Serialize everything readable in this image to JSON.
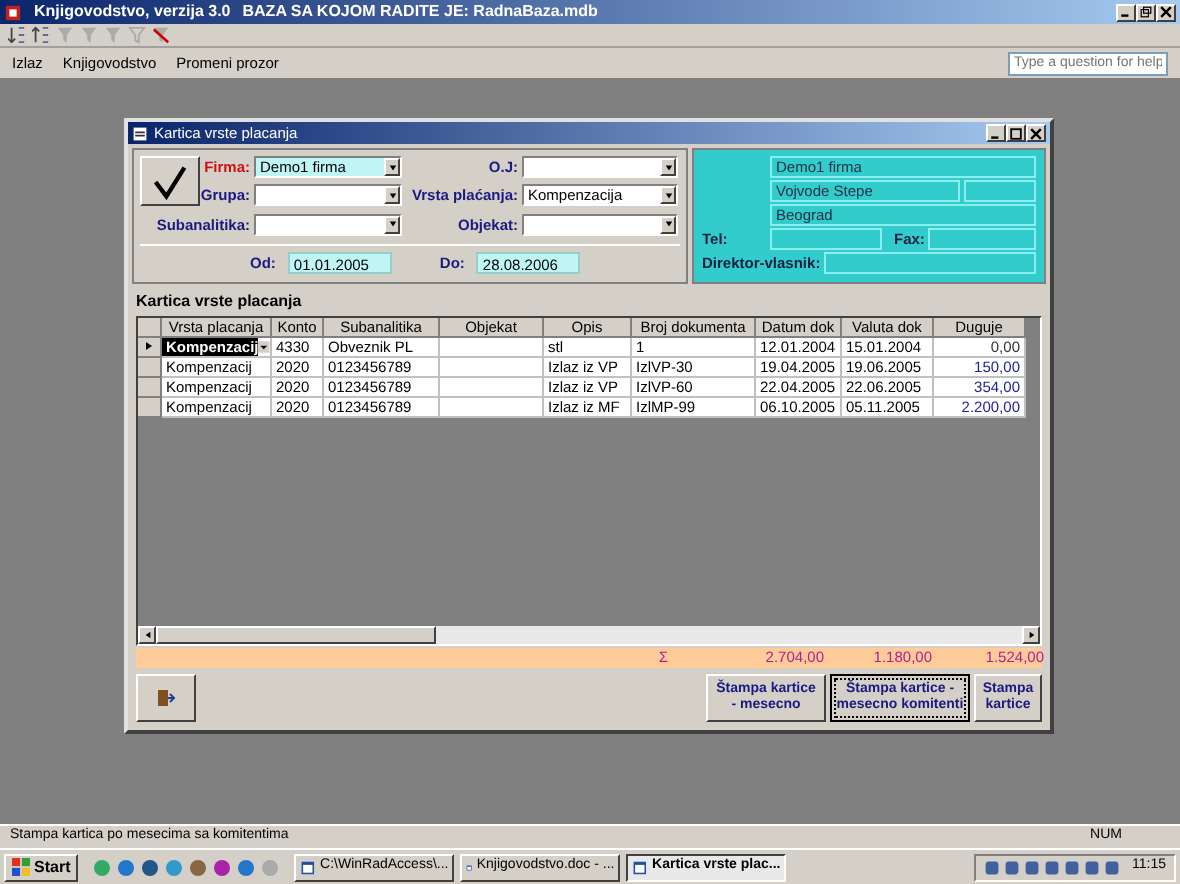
{
  "app_window": {
    "title": "Knjigovodstvo, verzija 3.0",
    "database": "BAZA SA KOJOM RADITE JE: RadnaBaza.mdb"
  },
  "menu": [
    "Izlaz",
    "Knjigovodstvo",
    "Promeni prozor"
  ],
  "help": {
    "placeholder": "Type a question for help"
  },
  "dialog": {
    "title": "Kartica vrste placanja",
    "fields": [
      {
        "label": "Firma:",
        "value": "Demo1 firma",
        "required": true,
        "highlighted": true
      },
      {
        "label": "O.J:",
        "required": false,
        "highlighted": false
      },
      {
        "label": "Grupa:",
        "required": false,
        "highlighted": false
      },
      {
        "label": "Vrsta plaćanja:",
        "value": "Kompenzacija",
        "required": false,
        "highlighted": false
      },
      {
        "label": "Subanalitika:",
        "required": false,
        "highlighted": false
      },
      {
        "label": "Objekat:",
        "required": false,
        "highlighted": false
      }
    ],
    "date_from": {
      "label": "Od:",
      "value": "01.01.2005"
    },
    "date_to": {
      "label": "Do:",
      "value": "28.08.2006"
    },
    "info_panel": {
      "company": "Demo1 firma",
      "address": "Vojvode Stepe",
      "city": "Beograd",
      "tel_label": "Tel:",
      "fax_label": "Fax:",
      "director_label": "Direktor-vlasnik:"
    },
    "subform": {
      "title": "Kartica vrste placanja",
      "columns": [
        "Vrsta placanja",
        "Konto",
        "Subanalitika",
        "Objekat",
        "Opis",
        "Broj dokumenta",
        "Datum dok",
        "Valuta dok",
        "Duguje"
      ],
      "rows": [
        {
          "selected": true,
          "cells": [
            "Kompenzacij",
            "4330",
            "Obveznik PL",
            "",
            "stl",
            "1",
            "12.01.2004",
            "15.01.2004",
            "0,00"
          ]
        },
        {
          "selected": false,
          "cells": [
            "Kompenzacij",
            "2020",
            "0123456789",
            "",
            "Izlaz iz VP",
            "IzlVP-30",
            "19.04.2005",
            "19.06.2005",
            "150,00"
          ]
        },
        {
          "selected": false,
          "cells": [
            "Kompenzacij",
            "2020",
            "0123456789",
            "",
            "Izlaz iz VP",
            "IzlVP-60",
            "22.04.2005",
            "22.06.2005",
            "354,00"
          ]
        },
        {
          "selected": false,
          "cells": [
            "Kompenzacij",
            "2020",
            "0123456789",
            "",
            "Izlaz iz MF",
            "IzlMP-99",
            "06.10.2005",
            "05.11.2005",
            "2.200,00"
          ]
        }
      ],
      "totals": {
        "sigma": "Σ",
        "values": [
          "2.704,00",
          "1.180,00",
          "1.524,00"
        ]
      }
    },
    "buttons": [
      {
        "label": "Štampa kartice - mesecno",
        "focused": false
      },
      {
        "label": "Štampa kartice - mesecno komitenti",
        "focused": true
      },
      {
        "label": "Stampa kartice",
        "focused": false
      }
    ]
  },
  "status_bar": {
    "text": "Stampa kartica po mesecima sa komitentima",
    "indicator": "NUM"
  },
  "taskbar": {
    "start": "Start",
    "tasks": [
      {
        "label": "C:\\WinRadAccess\\...",
        "selected": false
      },
      {
        "label": "Knjigovodstvo.doc - ...",
        "selected": false
      },
      {
        "label": "Kartica vrste plac...",
        "selected": true
      }
    ],
    "clock": "11:15"
  }
}
